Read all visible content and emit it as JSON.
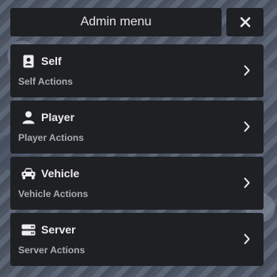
{
  "header": {
    "title": "Admin menu",
    "close_icon": "close-icon"
  },
  "items": [
    {
      "label": "Self",
      "sublabel": "Self Actions",
      "icon": "id-badge-icon"
    },
    {
      "label": "Player",
      "sublabel": "Player Actions",
      "icon": "user-icon"
    },
    {
      "label": "Vehicle",
      "sublabel": "Vehicle Actions",
      "icon": "car-icon"
    },
    {
      "label": "Server",
      "sublabel": "Server Actions",
      "icon": "server-icon"
    }
  ],
  "colors": {
    "panel_bg": "#1f2024",
    "text_primary": "#ececec",
    "text_secondary": "#a9abb0"
  }
}
